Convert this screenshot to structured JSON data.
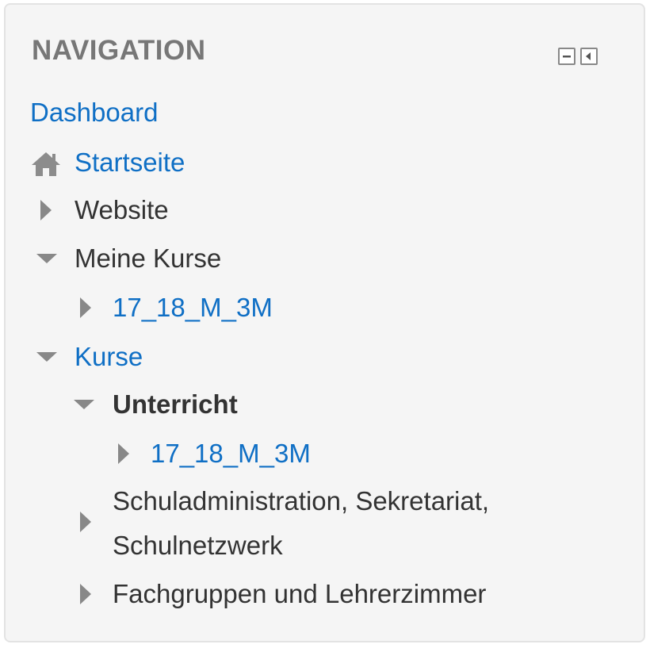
{
  "block": {
    "title": "NAVIGATION",
    "controls": [
      {
        "icon": "minus-icon",
        "action": "collapse"
      },
      {
        "icon": "dock-left-icon",
        "action": "dock"
      }
    ]
  },
  "nav": {
    "dashboard": "Dashboard",
    "startseite": "Startseite",
    "website": "Website",
    "meine_kurse": "Meine Kurse",
    "meine_kurse_course": "17_18_M_3M",
    "kurse": "Kurse",
    "unterricht": "Unterricht",
    "unterricht_course": "17_18_M_3M",
    "schuladmin_line1": "Schuladministration, Sekretariat,",
    "schuladmin_line2": "Schulnetzwerk",
    "fachgruppen": "Fachgruppen und Lehrerzimmer"
  },
  "colors": {
    "link": "#0f6fc5",
    "text": "#333333",
    "title": "#777777",
    "background": "#f5f5f5",
    "triangle": "#888888"
  }
}
